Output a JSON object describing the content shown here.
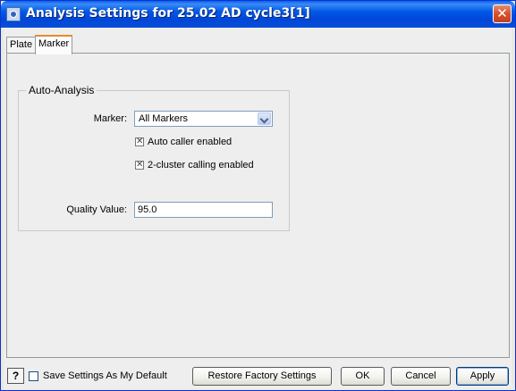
{
  "window": {
    "title": "Analysis Settings for 25.02 AD cycle3[1]",
    "close_glyph": "✕"
  },
  "tabs": [
    {
      "label": "Plate",
      "active": false
    },
    {
      "label": "Marker",
      "active": true
    }
  ],
  "auto_analysis": {
    "legend": "Auto-Analysis",
    "marker_label": "Marker:",
    "marker_value": "All Markers",
    "auto_caller": {
      "label": "Auto caller enabled",
      "checked": true
    },
    "two_cluster": {
      "label": "2-cluster calling enabled",
      "checked": true
    },
    "quality_label": "Quality Value:",
    "quality_value": "95.0"
  },
  "footer": {
    "help_glyph": "?",
    "save_default_label": "Save Settings As My Default",
    "save_default_checked": false,
    "restore_label": "Restore Factory Settings",
    "ok_label": "OK",
    "cancel_label": "Cancel",
    "apply_label": "Apply"
  },
  "icons": {
    "app": "app-icon",
    "close": "close-icon",
    "dropdown": "chevron-down-icon",
    "help": "help-icon"
  },
  "colors": {
    "titlebar": "#0058e6",
    "close_button": "#d5512b",
    "active_tab_accent": "#e68b2c",
    "panel_background": "#eeeeee",
    "input_border": "#7f9db9"
  }
}
